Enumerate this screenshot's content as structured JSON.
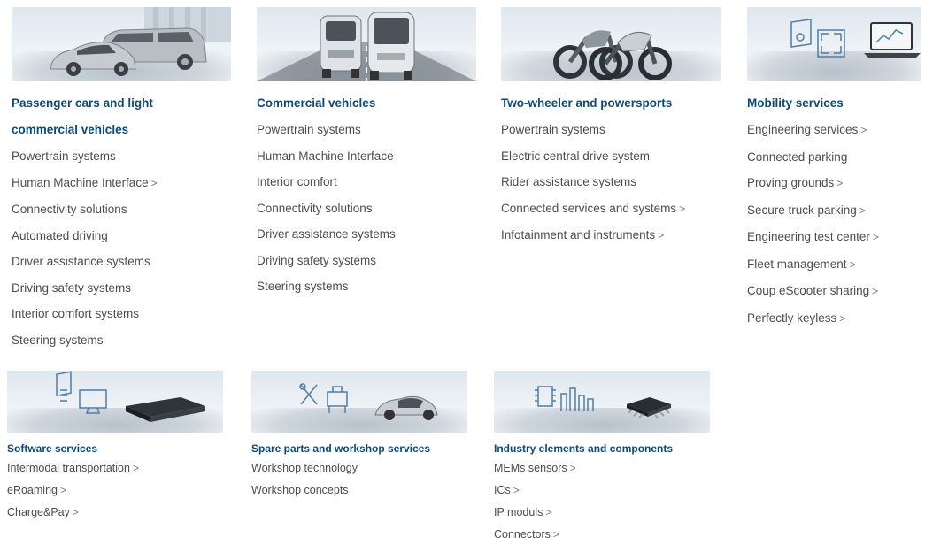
{
  "categories_top": [
    {
      "title_line1": "Passenger cars and light",
      "title_line2": "commercial vehicles",
      "image_icon": "car-van-image",
      "items": [
        {
          "label": "Powertrain systems",
          "chevron": ""
        },
        {
          "label": "Human Machine Interface",
          "chevron": ">"
        },
        {
          "label": "Connectivity solutions",
          "chevron": ""
        },
        {
          "label": "Automated driving",
          "chevron": ""
        },
        {
          "label": "Driver assistance systems",
          "chevron": ""
        },
        {
          "label": "Driving safety systems",
          "chevron": ""
        },
        {
          "label": "Interior comfort systems",
          "chevron": ""
        },
        {
          "label": "Steering systems",
          "chevron": ""
        }
      ]
    },
    {
      "title_line1": "Commercial vehicles",
      "image_icon": "truck-bus-image",
      "items": [
        {
          "label": "Powertrain systems",
          "chevron": ""
        },
        {
          "label": "Human Machine Interface",
          "chevron": ""
        },
        {
          "label": "Interior comfort",
          "chevron": ""
        },
        {
          "label": "Connectivity solutions",
          "chevron": ""
        },
        {
          "label": "Driver assistance systems",
          "chevron": ""
        },
        {
          "label": "Driving safety systems",
          "chevron": ""
        },
        {
          "label": "Steering systems",
          "chevron": ""
        }
      ]
    },
    {
      "title_line1": "Two-wheeler and powersports",
      "image_icon": "motorcycles-image",
      "items": [
        {
          "label": "Powertrain systems",
          "chevron": ""
        },
        {
          "label": "Electric central drive system",
          "chevron": ""
        },
        {
          "label": "Rider assistance systems",
          "chevron": ""
        },
        {
          "label": "Connected services and systems",
          "chevron": ">"
        },
        {
          "label": "Infotainment and instruments",
          "chevron": ">"
        }
      ]
    },
    {
      "title_line1": "Mobility services",
      "image_icon": "mobility-laptop-image",
      "items": [
        {
          "label": "Engineering services",
          "chevron": ">"
        },
        {
          "label": "Connected parking",
          "chevron": ""
        },
        {
          "label": "Proving grounds",
          "chevron": ">"
        },
        {
          "label": "Secure truck parking",
          "chevron": ">"
        },
        {
          "label": "Engineering test center",
          "chevron": ">"
        },
        {
          "label": "Fleet management",
          "chevron": ">"
        },
        {
          "label": "Coup eScooter sharing",
          "chevron": ">"
        },
        {
          "label": "Perfectly keyless",
          "chevron": ">"
        }
      ]
    }
  ],
  "categories_bottom": [
    {
      "title_line1": "Software services",
      "image_icon": "software-ecu-image",
      "items": [
        {
          "label": "Intermodal transportation",
          "chevron": ">"
        },
        {
          "label": "eRoaming",
          "chevron": ">"
        },
        {
          "label": "Charge&Pay",
          "chevron": ">"
        }
      ]
    },
    {
      "title_line1": "Spare parts and workshop services",
      "image_icon": "workshop-tools-image",
      "items": [
        {
          "label": "Workshop technology",
          "chevron": ""
        },
        {
          "label": "Workshop concepts",
          "chevron": ""
        }
      ]
    },
    {
      "title_line1": "Industry elements and components",
      "image_icon": "chip-components-image",
      "items": [
        {
          "label": "MEMs sensors",
          "chevron": ">"
        },
        {
          "label": "ICs",
          "chevron": ">"
        },
        {
          "label": "IP moduls",
          "chevron": ">"
        },
        {
          "label": "Connectors",
          "chevron": ">"
        }
      ]
    }
  ],
  "colors": {
    "title": "#0b4a7a",
    "item": "#4d4d4d",
    "chevron": "#777777"
  }
}
